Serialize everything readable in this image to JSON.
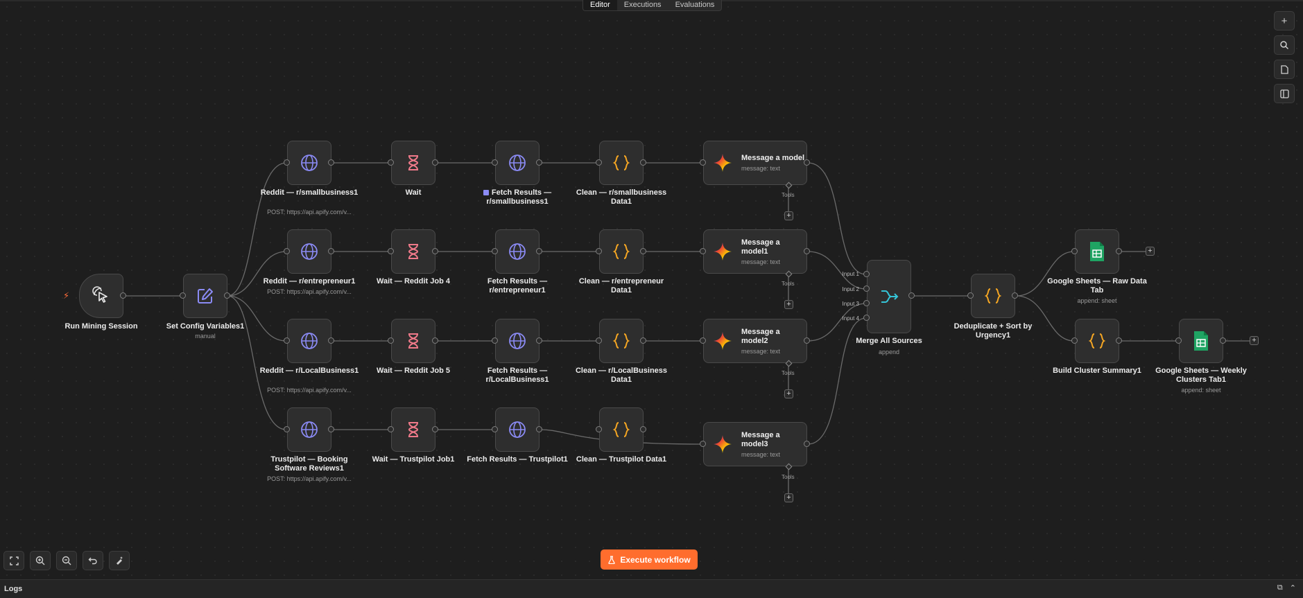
{
  "tabs": [
    {
      "label": "Editor",
      "active": true
    },
    {
      "label": "Executions",
      "active": false
    },
    {
      "label": "Evaluations",
      "active": false
    }
  ],
  "right_toolbar": [
    {
      "icon": "plus-icon",
      "glyph": "+"
    },
    {
      "icon": "search-icon",
      "glyph": "⌕"
    },
    {
      "icon": "sticky-note-icon",
      "glyph": "▢"
    },
    {
      "icon": "panel-icon",
      "glyph": "◫"
    }
  ],
  "bottom_toolbar": [
    {
      "icon": "fit-view-icon",
      "glyph": "⛶"
    },
    {
      "icon": "zoom-in-icon",
      "glyph": "⊕"
    },
    {
      "icon": "zoom-out-icon",
      "glyph": "⊖"
    },
    {
      "icon": "undo-icon",
      "glyph": "↶"
    },
    {
      "icon": "tidy-up-icon",
      "glyph": "✦"
    }
  ],
  "execute_button": {
    "label": "Execute workflow",
    "icon": "flask-icon"
  },
  "logs": {
    "label": "Logs"
  },
  "colors": {
    "accent": "#ff6d2d",
    "http": "#8b8bf5",
    "wait": "#f07a8a",
    "code": "#f5a623",
    "merge": "#35c5d8",
    "sheets": "#1fa463"
  },
  "nodes": {
    "trigger": {
      "title": "Run Mining Session",
      "icon": "cursor-click-icon"
    },
    "config": {
      "title": "Set Config Variables1",
      "sub": "manual",
      "icon": "edit-icon"
    },
    "req1": {
      "title": "Reddit — r/smallbusiness1",
      "sub": "POST: https://api.apify.com/v...",
      "icon": "globe-icon"
    },
    "req2": {
      "title": "Reddit — r/entrepreneur1",
      "sub": "POST: https://api.apify.com/v...",
      "icon": "globe-icon"
    },
    "req3": {
      "title": "Reddit — r/LocalBusiness1",
      "sub": "POST: https://api.apify.com/v...",
      "icon": "globe-icon"
    },
    "req4": {
      "title": "Trustpilot — Booking Software Reviews1",
      "sub": "POST: https://api.apify.com/v...",
      "icon": "globe-icon"
    },
    "wait1": {
      "title": "Wait",
      "icon": "hourglass-icon"
    },
    "wait2": {
      "title": "Wait — Reddit Job 4",
      "icon": "hourglass-icon"
    },
    "wait3": {
      "title": "Wait — Reddit Job 5",
      "icon": "hourglass-icon"
    },
    "wait4": {
      "title": "Wait — Trustpilot Job1",
      "icon": "hourglass-icon"
    },
    "fetch1": {
      "title": "Fetch Results — r/smallbusiness1",
      "icon": "globe-icon"
    },
    "fetch2": {
      "title": "Fetch Results — r/entrepreneur1",
      "icon": "globe-icon"
    },
    "fetch3": {
      "title": "Fetch Results — r/LocalBusiness1",
      "icon": "globe-icon"
    },
    "fetch4": {
      "title": "Fetch Results — Trustpilot1",
      "icon": "globe-icon"
    },
    "clean1": {
      "title": "Clean — r/smallbusiness Data1",
      "icon": "code-braces-icon"
    },
    "clean2": {
      "title": "Clean — r/entrepreneur Data1",
      "icon": "code-braces-icon"
    },
    "clean3": {
      "title": "Clean — r/LocalBusiness Data1",
      "icon": "code-braces-icon"
    },
    "clean4": {
      "title": "Clean — Trustpilot Data1",
      "icon": "code-braces-icon"
    },
    "msg1": {
      "title": "Message a model",
      "sub": "message: text",
      "tools": "Tools",
      "icon": "gemini-icon"
    },
    "msg2": {
      "title": "Message a model1",
      "sub": "message: text",
      "tools": "Tools",
      "icon": "gemini-icon"
    },
    "msg3": {
      "title": "Message a model2",
      "sub": "message: text",
      "tools": "Tools",
      "icon": "gemini-icon"
    },
    "msg4": {
      "title": "Message a model3",
      "sub": "message: text",
      "tools": "Tools",
      "icon": "gemini-icon"
    },
    "merge": {
      "title": "Merge All Sources",
      "sub": "append",
      "icon": "merge-icon",
      "inputs": [
        "Input 1",
        "Input 2",
        "Input 3",
        "Input 4"
      ]
    },
    "dedupe": {
      "title": "Deduplicate + Sort by Urgency1",
      "icon": "code-braces-icon"
    },
    "sheets1": {
      "title": "Google Sheets — Raw Data Tab",
      "sub": "append: sheet",
      "icon": "google-sheets-icon"
    },
    "cluster": {
      "title": "Build Cluster Summary1",
      "icon": "code-braces-icon"
    },
    "sheets2": {
      "title": "Google Sheets — Weekly Clusters Tab1",
      "sub": "append: sheet",
      "icon": "google-sheets-icon"
    }
  }
}
